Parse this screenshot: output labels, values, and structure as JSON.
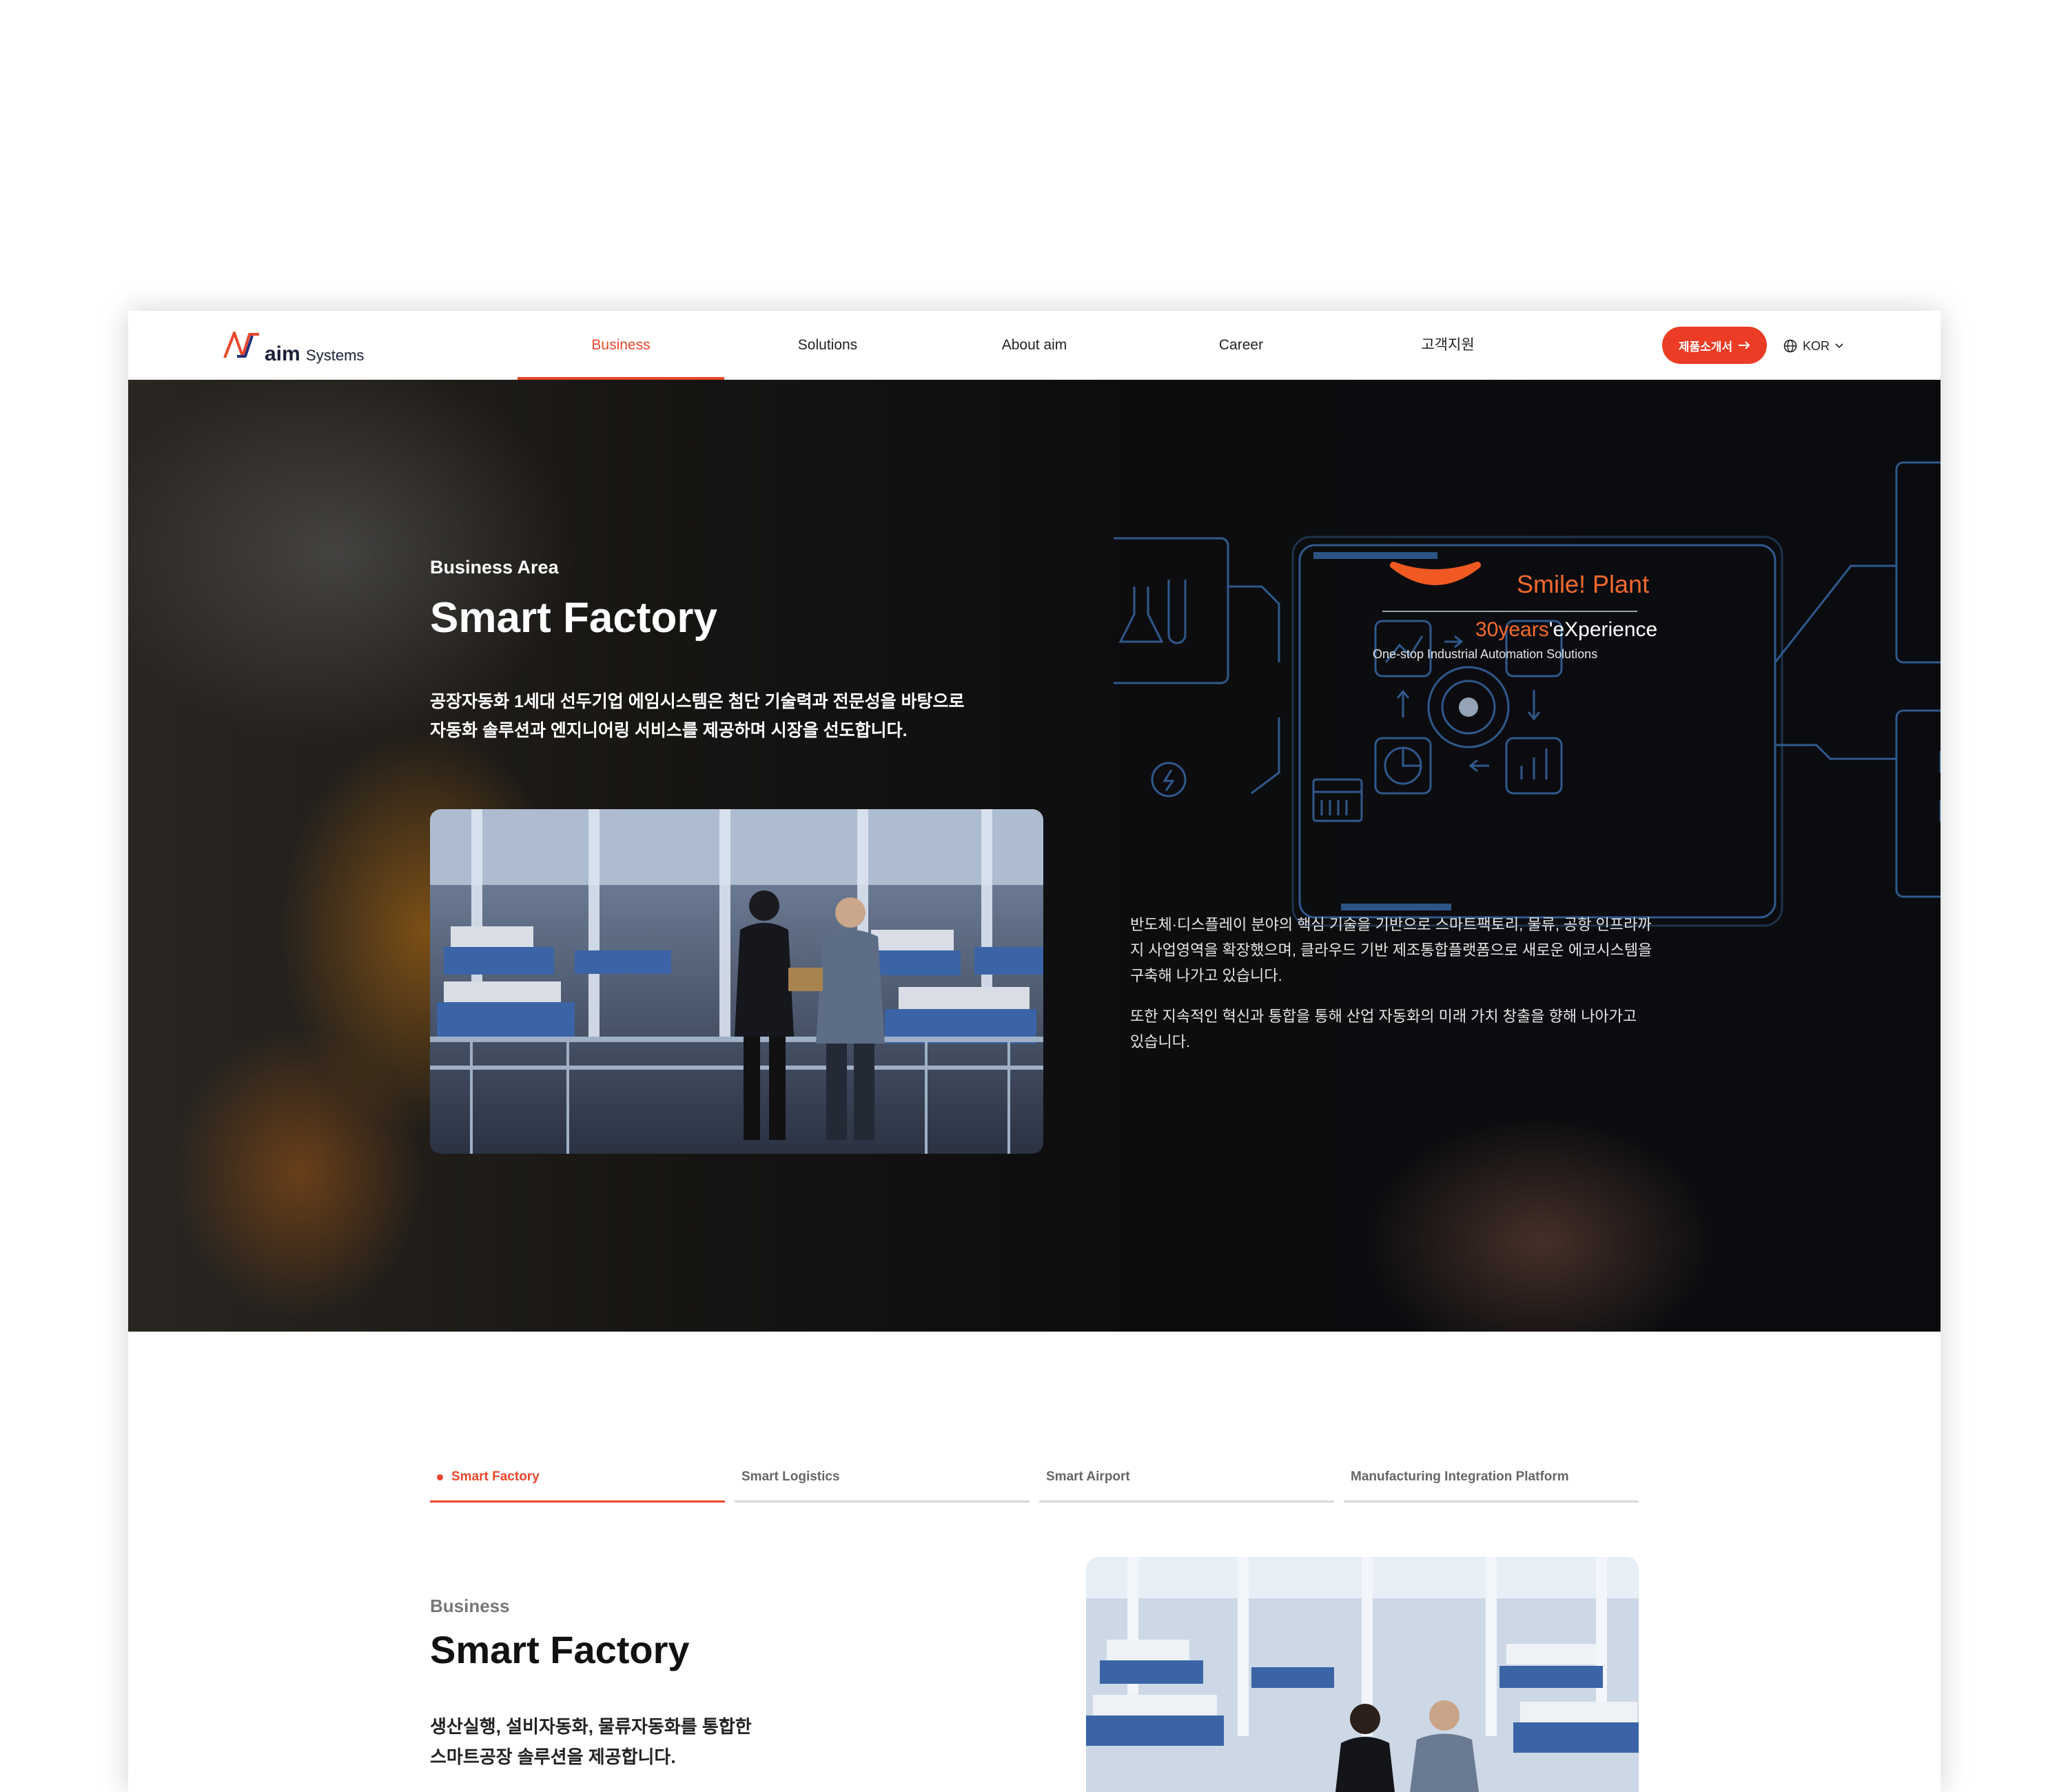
{
  "brand": {
    "logo_word": "aim",
    "logo_suffix": "Systems",
    "accent": "#e9472c",
    "cta_color": "#ec3c25"
  },
  "nav": {
    "items": [
      {
        "label": "Business",
        "active": true
      },
      {
        "label": "Solutions"
      },
      {
        "label": "About aim"
      },
      {
        "label": "Career"
      },
      {
        "label": "고객지원"
      }
    ],
    "cta_label": "제품소개서",
    "lang_label": "KOR"
  },
  "hero": {
    "tag": "Business Area",
    "title": "Smart Factory",
    "desc_line1": "공장자동화 1세대 선두기업 에임시스템은 첨단 기술력과 전문성을 바탕으로",
    "desc_line2": "자동화 솔루션과 엔지니어링 서비스를 제공하며 시장을 선도합니다.",
    "right_p1": "반도체·디스플레이 분야의 핵심 기술을 기반으로 스마트팩토리, 물류, 공항 인프라까지 사업영역을 확장했으며, 클라우드 기반 제조통합플랫폼으로 새로운 에코시스템을 구축해 나가고 있습니다.",
    "right_p2": "또한 지속적인 혁신과 통합을 통해 산업 자동화의 미래 가치 창출을 향해 나아가고 있습니다.",
    "overlay": {
      "smile_label": "Smile! Plant",
      "years_label": "30years",
      "experience_label": "'eXperience",
      "tagline": "One-stop Industrial  Automation Solutions"
    }
  },
  "tabs": [
    {
      "label": "Smart Factory",
      "active": true
    },
    {
      "label": "Smart Logistics"
    },
    {
      "label": "Smart Airport"
    },
    {
      "label": "Manufacturing Integration Platform"
    }
  ],
  "section": {
    "tag": "Business",
    "title": "Smart Factory",
    "desc_line1": "생산실행, 설비자동화, 물류자동화를 통합한",
    "desc_line2": "스마트공장 솔루션을 제공합니다."
  }
}
